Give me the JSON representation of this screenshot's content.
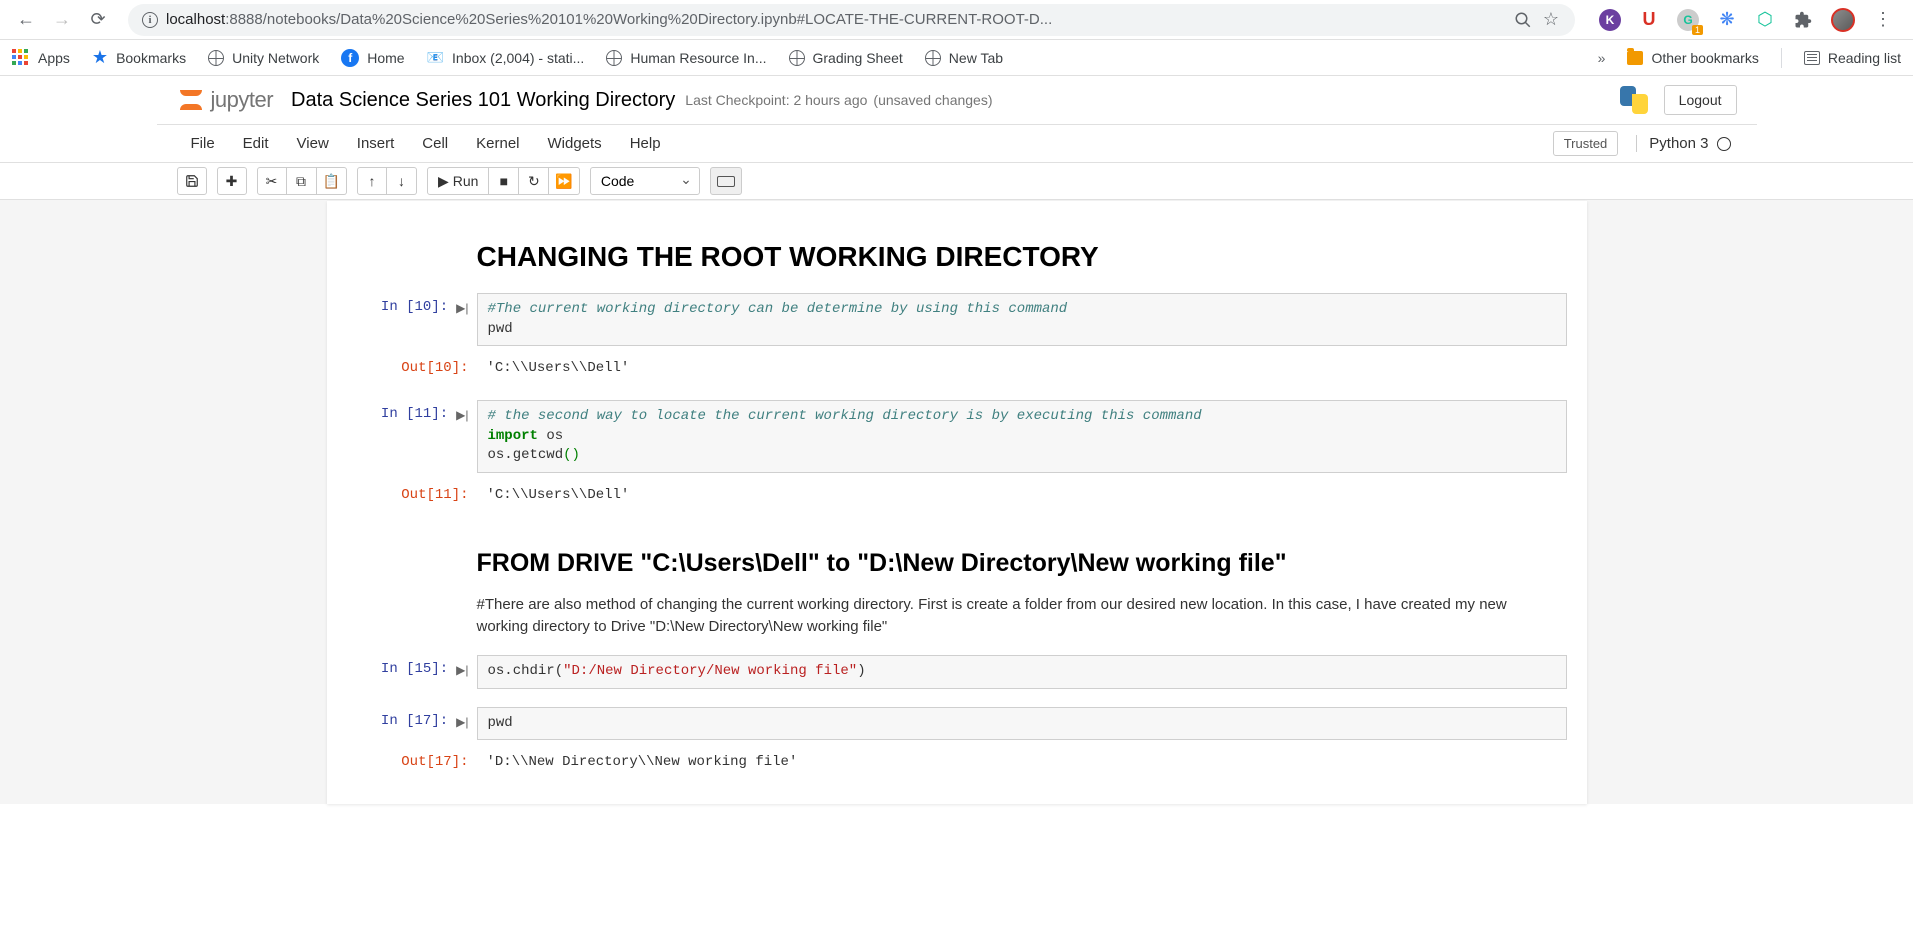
{
  "browser": {
    "url_host": "localhost",
    "url_port": ":8888",
    "url_path": "/notebooks/Data%20Science%20Series%20101%20Working%20Directory.ipynb#LOCATE-THE-CURRENT-ROOT-D...",
    "ext_badge": "1",
    "u_icon": "U",
    "k_icon": "K"
  },
  "bookmarks": {
    "apps": "Apps",
    "items": [
      {
        "label": "Bookmarks"
      },
      {
        "label": "Unity Network"
      },
      {
        "label": "Home"
      },
      {
        "label": "Inbox (2,004) - stati..."
      },
      {
        "label": "Human Resource In..."
      },
      {
        "label": "Grading Sheet"
      },
      {
        "label": "New Tab"
      }
    ],
    "overflow": "»",
    "other": "Other bookmarks",
    "reading": "Reading list"
  },
  "jupyter": {
    "logo": "jupyter",
    "title": "Data Science Series 101 Working Directory",
    "checkpoint": "Last Checkpoint: 2 hours ago",
    "unsaved": "(unsaved changes)",
    "logout": "Logout"
  },
  "menus": {
    "items": [
      "File",
      "Edit",
      "View",
      "Insert",
      "Cell",
      "Kernel",
      "Widgets",
      "Help"
    ],
    "trusted": "Trusted",
    "kernel": "Python 3"
  },
  "toolbar": {
    "run": "Run",
    "cell_type": "Code"
  },
  "cells": {
    "heading1": "CHANGING THE ROOT WORKING DIRECTORY",
    "in10": "In [10]:",
    "in10_comment": "#The current working directory can be determine by using this command",
    "in10_code": "pwd",
    "out10": "Out[10]:",
    "out10_val": "'C:\\\\Users\\\\Dell'",
    "in11": "In [11]:",
    "in11_comment": "# the second way to locate the current working directory is by executing this command",
    "in11_import": "import",
    "in11_os": " os",
    "in11_code": "os.getcwd",
    "out11": "Out[11]:",
    "out11_val": "'C:\\\\Users\\\\Dell'",
    "heading2": "FROM DRIVE \"C:\\Users\\Dell\" to \"D:\\New Directory\\New working file\"",
    "para": "#There are also method of changing the current working directory. First is create a folder from our desired new location. In this case, I have created my new working directory to Drive \"D:\\New Directory\\New working file\"",
    "in15": "In [15]:",
    "in15_code1": "os.chdir(",
    "in15_str": "\"D:/New Directory/New working file\"",
    "in15_code2": ")",
    "in17": "In [17]:",
    "in17_code": "pwd",
    "out17": "Out[17]:",
    "out17_val": "'D:\\\\New Directory\\\\New working file'"
  }
}
